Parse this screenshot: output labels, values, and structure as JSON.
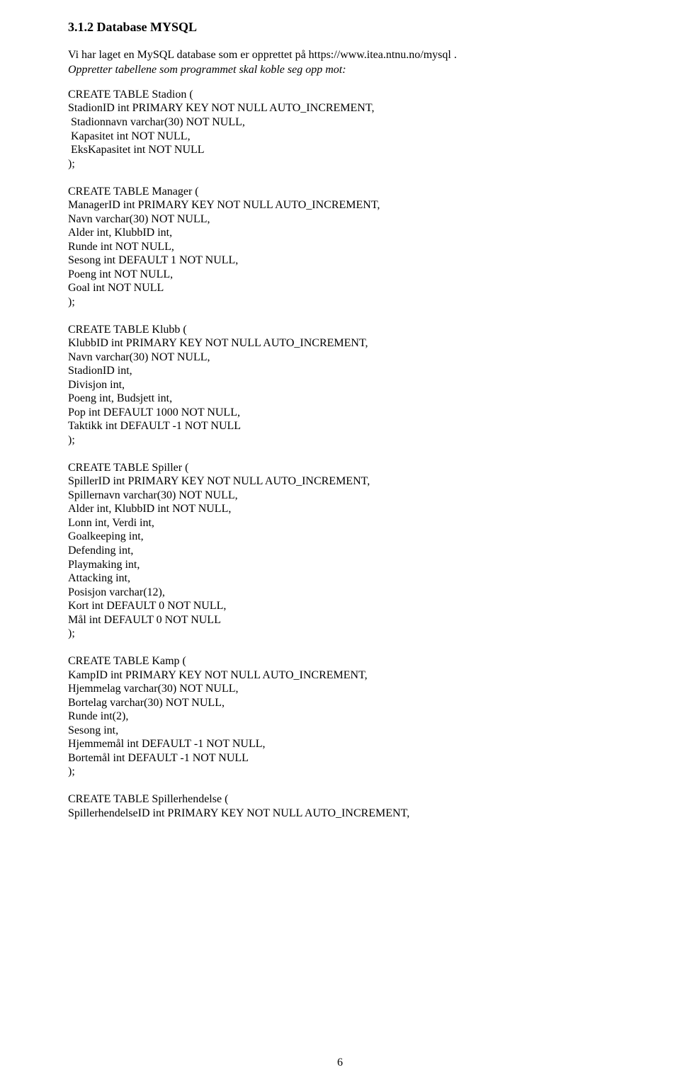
{
  "heading": "3.1.2 Database MYSQL",
  "intro_line1": "Vi har laget en MySQL database som er opprettet på https://www.itea.ntnu.no/mysql .",
  "intro_line2": "Oppretter tabellene som programmet skal koble seg opp mot:",
  "code": "CREATE TABLE Stadion (\nStadionID int PRIMARY KEY NOT NULL AUTO_INCREMENT,\n Stadionnavn varchar(30) NOT NULL,\n Kapasitet int NOT NULL,\n EksKapasitet int NOT NULL\n);\n\nCREATE TABLE Manager (\nManagerID int PRIMARY KEY NOT NULL AUTO_INCREMENT,\nNavn varchar(30) NOT NULL,\nAlder int, KlubbID int,\nRunde int NOT NULL,\nSesong int DEFAULT 1 NOT NULL,\nPoeng int NOT NULL,\nGoal int NOT NULL\n);\n\nCREATE TABLE Klubb (\nKlubbID int PRIMARY KEY NOT NULL AUTO_INCREMENT,\nNavn varchar(30) NOT NULL,\nStadionID int,\nDivisjon int,\nPoeng int, Budsjett int,\nPop int DEFAULT 1000 NOT NULL,\nTaktikk int DEFAULT -1 NOT NULL\n);\n\nCREATE TABLE Spiller (\nSpillerID int PRIMARY KEY NOT NULL AUTO_INCREMENT,\nSpillernavn varchar(30) NOT NULL,\nAlder int, KlubbID int NOT NULL,\nLonn int, Verdi int,\nGoalkeeping int,\nDefending int,\nPlaymaking int,\nAttacking int,\nPosisjon varchar(12),\nKort int DEFAULT 0 NOT NULL,\nMål int DEFAULT 0 NOT NULL\n);\n\nCREATE TABLE Kamp (\nKampID int PRIMARY KEY NOT NULL AUTO_INCREMENT,\nHjemmelag varchar(30) NOT NULL,\nBortelag varchar(30) NOT NULL,\nRunde int(2),\nSesong int,\nHjemmemål int DEFAULT -1 NOT NULL,\nBortemål int DEFAULT -1 NOT NULL\n);\n\nCREATE TABLE Spillerhendelse (\nSpillerhendelseID int PRIMARY KEY NOT NULL AUTO_INCREMENT,",
  "page_number": "6"
}
